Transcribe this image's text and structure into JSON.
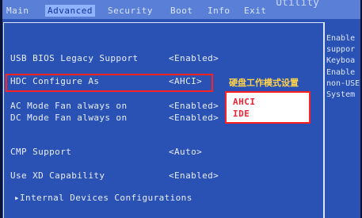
{
  "tabs": [
    {
      "label": "Main",
      "active": false
    },
    {
      "label": "Advanced",
      "active": true
    },
    {
      "label": "Security",
      "active": false
    },
    {
      "label": "Boot",
      "active": false
    },
    {
      "label": "Info",
      "active": false
    },
    {
      "label": "Exit",
      "active": false
    }
  ],
  "title_fragment": "Utility",
  "settings": [
    {
      "label": "USB BIOS Legacy Support",
      "value": "<Enabled>"
    },
    {
      "label": "HDC Configure As",
      "value": "<AHCI>"
    },
    {
      "label": "AC Mode Fan always on",
      "value": "<Enabled>"
    },
    {
      "label": "DC Mode Fan always on",
      "value": "<Enabled>"
    },
    {
      "label": "CMP Support",
      "value": "<Auto>"
    },
    {
      "label": "Use XD Capability",
      "value": "<Enabled>"
    },
    {
      "label": "▸Internal Devices Configurations",
      "value": ""
    }
  ],
  "help_panel": [
    "Enable",
    "suppor",
    "Keyboa",
    "Enable",
    "non-USE",
    "System"
  ],
  "annotation": "硬盘工作模式设置",
  "options": [
    "AHCI",
    "IDE"
  ],
  "colors": {
    "bios_blue": "#2a52b4",
    "highlight_red": "#ff2020",
    "annotation_yellow": "#ffd24a"
  }
}
